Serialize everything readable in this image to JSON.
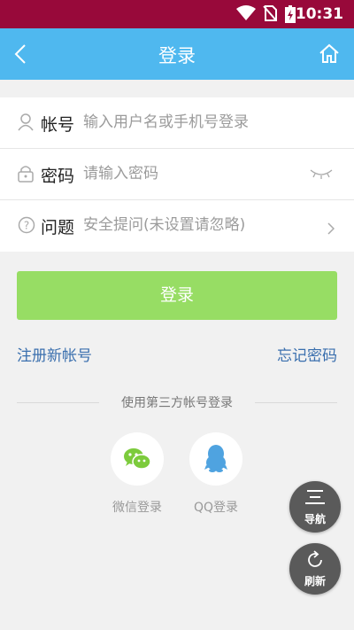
{
  "status_bar": {
    "time": "10:31"
  },
  "header": {
    "title": "登录"
  },
  "form": {
    "account_label": "帐号",
    "account_placeholder": "输入用户名或手机号登录",
    "password_label": "密码",
    "password_placeholder": "请输入密码",
    "question_label": "问题",
    "question_placeholder": "安全提问(未设置请忽略)"
  },
  "login_button": "登录",
  "links": {
    "register": "注册新帐号",
    "forgot": "忘记密码"
  },
  "third_party": {
    "heading": "使用第三方帐号登录",
    "wechat_label": "微信登录",
    "qq_label": "QQ登录"
  },
  "floating": {
    "nav_label": "导航",
    "refresh_label": "刷新"
  },
  "colors": {
    "status_bar": "#98093a",
    "app_bar": "#4fb8ef",
    "button": "#97dd64",
    "link": "#3a6fae"
  }
}
